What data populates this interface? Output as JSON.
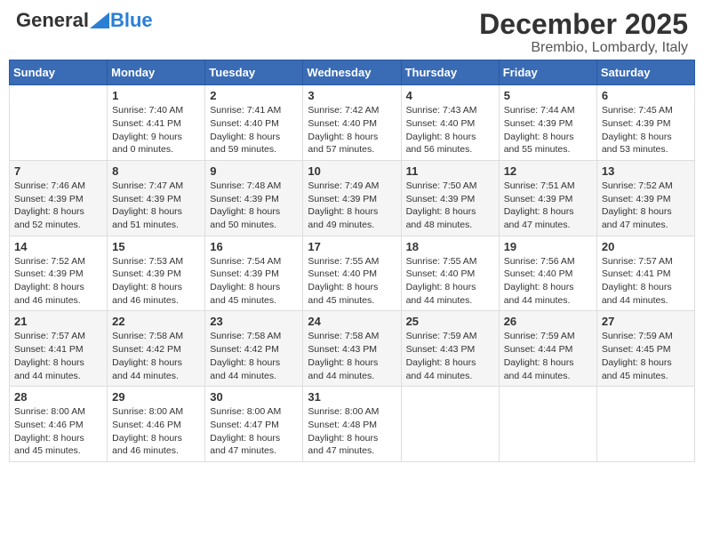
{
  "header": {
    "logo_general": "General",
    "logo_blue": "Blue",
    "month_title": "December 2025",
    "location": "Brembio, Lombardy, Italy"
  },
  "days_of_week": [
    "Sunday",
    "Monday",
    "Tuesday",
    "Wednesday",
    "Thursday",
    "Friday",
    "Saturday"
  ],
  "weeks": [
    {
      "shaded": false,
      "days": [
        {
          "num": "",
          "info": ""
        },
        {
          "num": "1",
          "info": "Sunrise: 7:40 AM\nSunset: 4:41 PM\nDaylight: 9 hours\nand 0 minutes."
        },
        {
          "num": "2",
          "info": "Sunrise: 7:41 AM\nSunset: 4:40 PM\nDaylight: 8 hours\nand 59 minutes."
        },
        {
          "num": "3",
          "info": "Sunrise: 7:42 AM\nSunset: 4:40 PM\nDaylight: 8 hours\nand 57 minutes."
        },
        {
          "num": "4",
          "info": "Sunrise: 7:43 AM\nSunset: 4:40 PM\nDaylight: 8 hours\nand 56 minutes."
        },
        {
          "num": "5",
          "info": "Sunrise: 7:44 AM\nSunset: 4:39 PM\nDaylight: 8 hours\nand 55 minutes."
        },
        {
          "num": "6",
          "info": "Sunrise: 7:45 AM\nSunset: 4:39 PM\nDaylight: 8 hours\nand 53 minutes."
        }
      ]
    },
    {
      "shaded": true,
      "days": [
        {
          "num": "7",
          "info": "Sunrise: 7:46 AM\nSunset: 4:39 PM\nDaylight: 8 hours\nand 52 minutes."
        },
        {
          "num": "8",
          "info": "Sunrise: 7:47 AM\nSunset: 4:39 PM\nDaylight: 8 hours\nand 51 minutes."
        },
        {
          "num": "9",
          "info": "Sunrise: 7:48 AM\nSunset: 4:39 PM\nDaylight: 8 hours\nand 50 minutes."
        },
        {
          "num": "10",
          "info": "Sunrise: 7:49 AM\nSunset: 4:39 PM\nDaylight: 8 hours\nand 49 minutes."
        },
        {
          "num": "11",
          "info": "Sunrise: 7:50 AM\nSunset: 4:39 PM\nDaylight: 8 hours\nand 48 minutes."
        },
        {
          "num": "12",
          "info": "Sunrise: 7:51 AM\nSunset: 4:39 PM\nDaylight: 8 hours\nand 47 minutes."
        },
        {
          "num": "13",
          "info": "Sunrise: 7:52 AM\nSunset: 4:39 PM\nDaylight: 8 hours\nand 47 minutes."
        }
      ]
    },
    {
      "shaded": false,
      "days": [
        {
          "num": "14",
          "info": "Sunrise: 7:52 AM\nSunset: 4:39 PM\nDaylight: 8 hours\nand 46 minutes."
        },
        {
          "num": "15",
          "info": "Sunrise: 7:53 AM\nSunset: 4:39 PM\nDaylight: 8 hours\nand 46 minutes."
        },
        {
          "num": "16",
          "info": "Sunrise: 7:54 AM\nSunset: 4:39 PM\nDaylight: 8 hours\nand 45 minutes."
        },
        {
          "num": "17",
          "info": "Sunrise: 7:55 AM\nSunset: 4:40 PM\nDaylight: 8 hours\nand 45 minutes."
        },
        {
          "num": "18",
          "info": "Sunrise: 7:55 AM\nSunset: 4:40 PM\nDaylight: 8 hours\nand 44 minutes."
        },
        {
          "num": "19",
          "info": "Sunrise: 7:56 AM\nSunset: 4:40 PM\nDaylight: 8 hours\nand 44 minutes."
        },
        {
          "num": "20",
          "info": "Sunrise: 7:57 AM\nSunset: 4:41 PM\nDaylight: 8 hours\nand 44 minutes."
        }
      ]
    },
    {
      "shaded": true,
      "days": [
        {
          "num": "21",
          "info": "Sunrise: 7:57 AM\nSunset: 4:41 PM\nDaylight: 8 hours\nand 44 minutes."
        },
        {
          "num": "22",
          "info": "Sunrise: 7:58 AM\nSunset: 4:42 PM\nDaylight: 8 hours\nand 44 minutes."
        },
        {
          "num": "23",
          "info": "Sunrise: 7:58 AM\nSunset: 4:42 PM\nDaylight: 8 hours\nand 44 minutes."
        },
        {
          "num": "24",
          "info": "Sunrise: 7:58 AM\nSunset: 4:43 PM\nDaylight: 8 hours\nand 44 minutes."
        },
        {
          "num": "25",
          "info": "Sunrise: 7:59 AM\nSunset: 4:43 PM\nDaylight: 8 hours\nand 44 minutes."
        },
        {
          "num": "26",
          "info": "Sunrise: 7:59 AM\nSunset: 4:44 PM\nDaylight: 8 hours\nand 44 minutes."
        },
        {
          "num": "27",
          "info": "Sunrise: 7:59 AM\nSunset: 4:45 PM\nDaylight: 8 hours\nand 45 minutes."
        }
      ]
    },
    {
      "shaded": false,
      "days": [
        {
          "num": "28",
          "info": "Sunrise: 8:00 AM\nSunset: 4:46 PM\nDaylight: 8 hours\nand 45 minutes."
        },
        {
          "num": "29",
          "info": "Sunrise: 8:00 AM\nSunset: 4:46 PM\nDaylight: 8 hours\nand 46 minutes."
        },
        {
          "num": "30",
          "info": "Sunrise: 8:00 AM\nSunset: 4:47 PM\nDaylight: 8 hours\nand 47 minutes."
        },
        {
          "num": "31",
          "info": "Sunrise: 8:00 AM\nSunset: 4:48 PM\nDaylight: 8 hours\nand 47 minutes."
        },
        {
          "num": "",
          "info": ""
        },
        {
          "num": "",
          "info": ""
        },
        {
          "num": "",
          "info": ""
        }
      ]
    }
  ]
}
